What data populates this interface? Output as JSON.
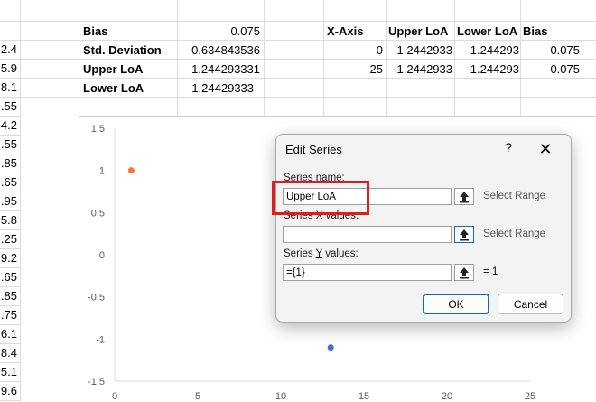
{
  "sheet": {
    "col_a_values": [
      "2.4",
      "5.9",
      "8.1",
      ".55",
      "4.2",
      ".55",
      ".85",
      ".65",
      ".95",
      "5.8",
      ".25",
      "9.2",
      ".65",
      ".85",
      ".75",
      "6.1",
      "8.4",
      "5.1",
      "9.6"
    ],
    "stats": [
      {
        "label": "Bias",
        "value": "0.075"
      },
      {
        "label": "Std. Deviation",
        "value": "0.634843536"
      },
      {
        "label": "Upper LoA",
        "value": "1.244293331"
      },
      {
        "label": "Lower LoA",
        "value": "-1.24429333"
      }
    ],
    "loa_table": {
      "headers": [
        "X-Axis",
        "Upper LoA",
        "Lower LoA",
        "Bias"
      ],
      "rows": [
        [
          "0",
          "1.2442933",
          "-1.244293",
          "0.075"
        ],
        [
          "25",
          "1.2442933",
          "-1.244293",
          "0.075"
        ]
      ]
    }
  },
  "chart_data": {
    "type": "scatter",
    "xlim": [
      0,
      25
    ],
    "ylim": [
      -1.5,
      1.5
    ],
    "x_ticks": [
      "0",
      "5",
      "10",
      "15",
      "20",
      "25"
    ],
    "y_ticks": [
      "1.5",
      "1",
      "0.5",
      "0",
      "-0.5",
      "-1",
      "-1.5"
    ],
    "series": [
      {
        "color": "#ed7d31",
        "points": [
          [
            1,
            1
          ]
        ]
      },
      {
        "color": "#4472c4",
        "points": [
          [
            13,
            -1.1
          ]
        ]
      }
    ],
    "grid": false
  },
  "dialog": {
    "title": "Edit Series",
    "help": "?",
    "close": "✕",
    "series_name_label": "Series name:",
    "series_name_value": "Upper LoA",
    "x_values_label_pre": "Series ",
    "x_values_label_u": "X",
    "x_values_label_post": " values:",
    "x_values_value": "",
    "y_values_label_pre": "Series ",
    "y_values_label_u": "Y",
    "y_values_label_post": " values:",
    "y_values_value": "={1}",
    "select_range": "Select Range",
    "y_result": "= 1",
    "ok_label": "OK",
    "cancel_label": "Cancel"
  }
}
